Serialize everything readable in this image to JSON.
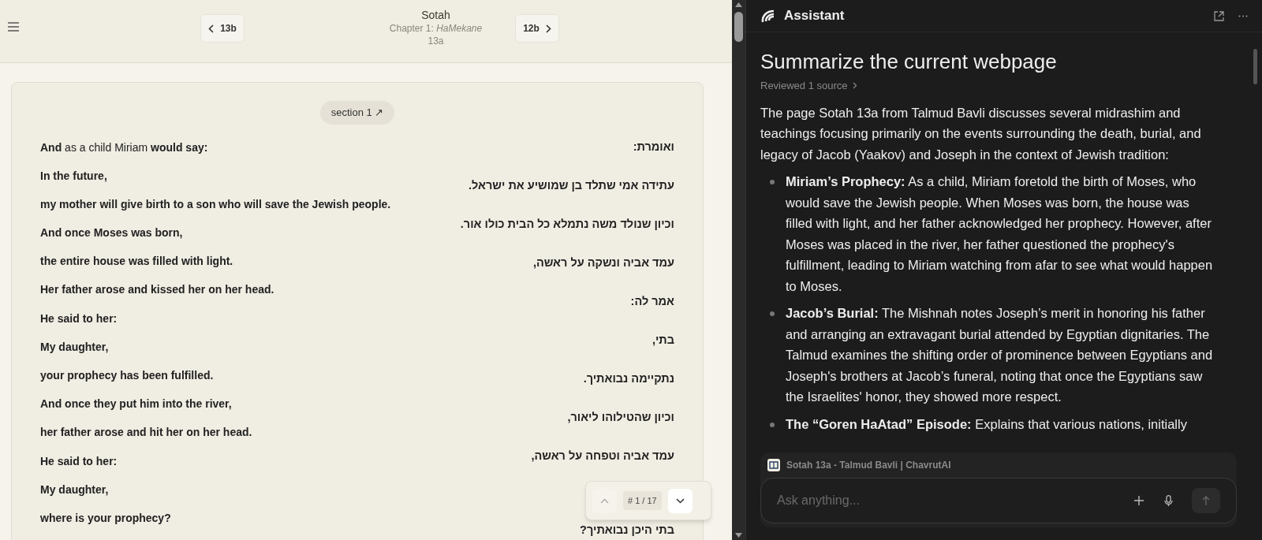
{
  "reader": {
    "nav": {
      "prev": "13b",
      "next": "12b",
      "title": "Sotah",
      "chapter": "Chapter 1: *HaMekane*",
      "page": "13a"
    },
    "section": {
      "label": "section 1 ↗"
    },
    "english": [
      {
        "text": "**And** as a child Miriam **would say:**",
        "kind": "mixed"
      },
      {
        "text": "In the future,",
        "kind": "bold"
      },
      {
        "text": "my mother will give birth to a son who will save the Jewish people.",
        "kind": "bold"
      },
      {
        "text": "And once Moses was born,",
        "kind": "bold"
      },
      {
        "text": "the entire house was filled with light.",
        "kind": "bold"
      },
      {
        "text": "Her father arose and kissed her on her head.",
        "kind": "bold"
      },
      {
        "text": "He said to her:",
        "kind": "bold"
      },
      {
        "text": "My daughter,",
        "kind": "bold"
      },
      {
        "text": "your prophecy has been fulfilled.",
        "kind": "bold"
      },
      {
        "text": "And once they put him into the river,",
        "kind": "bold"
      },
      {
        "text": "her father arose and hit her on her head.",
        "kind": "bold"
      },
      {
        "text": "He said to her:",
        "kind": "bold"
      },
      {
        "text": "My daughter,",
        "kind": "bold"
      },
      {
        "text": "where is your prophecy?",
        "kind": "bold"
      }
    ],
    "hebrew": [
      "ואומרת:",
      "עתידה אמי שתלד בן שמושיע את ישראל.",
      "וכיון שנולד משה נתמלא כל הבית כולו אור.",
      "עמד אביה ונשקה על ראשה,",
      "אמר לה:",
      "בתי,",
      "נתקיימה נבואתיך.",
      "וכיון שהטילוהו ליאור,",
      "עמד אביה וטפחה על ראשה,",
      "בתי היכן נבואתיך?"
    ],
    "segment_nav": {
      "counter": "# 1 / 17"
    }
  },
  "assistant": {
    "title": "Assistant",
    "heading": "Summarize the current webpage",
    "sources": "Reviewed 1 source",
    "intro": "The page Sotah 13a from Talmud Bavli discusses several midrashim and teachings focusing primarily on the events surrounding the death, burial, and legacy of Jacob (Yaakov) and Joseph in the context of Jewish tradition:",
    "bullets": [
      "**Miriam’s Prophecy:** As a child, Miriam foretold the birth of Moses, who would save the Jewish people. When Moses was born, the house was filled with light, and her father acknowledged her prophecy. However, after Moses was placed in the river, her father questioned the prophecy's fulfillment, leading to Miriam watching from afar to see what would happen to Moses.",
      "**Jacob’s Burial:** The Mishnah notes Joseph’s merit in honoring his father and arranging an extravagant burial attended by Egyptian dignitaries. The Talmud examines the shifting order of prominence between Egyptians and Joseph's brothers at Jacob’s funeral, noting that once the Egyptians saw the Israelites' honor, they showed more respect.",
      "**The “Goren HaAtad” Episode:** Explains that various nations, initially"
    ],
    "context": "Sotah 13a - Talmud Bavli | ChavrutAI",
    "input": {
      "placeholder": "Ask anything..."
    }
  }
}
